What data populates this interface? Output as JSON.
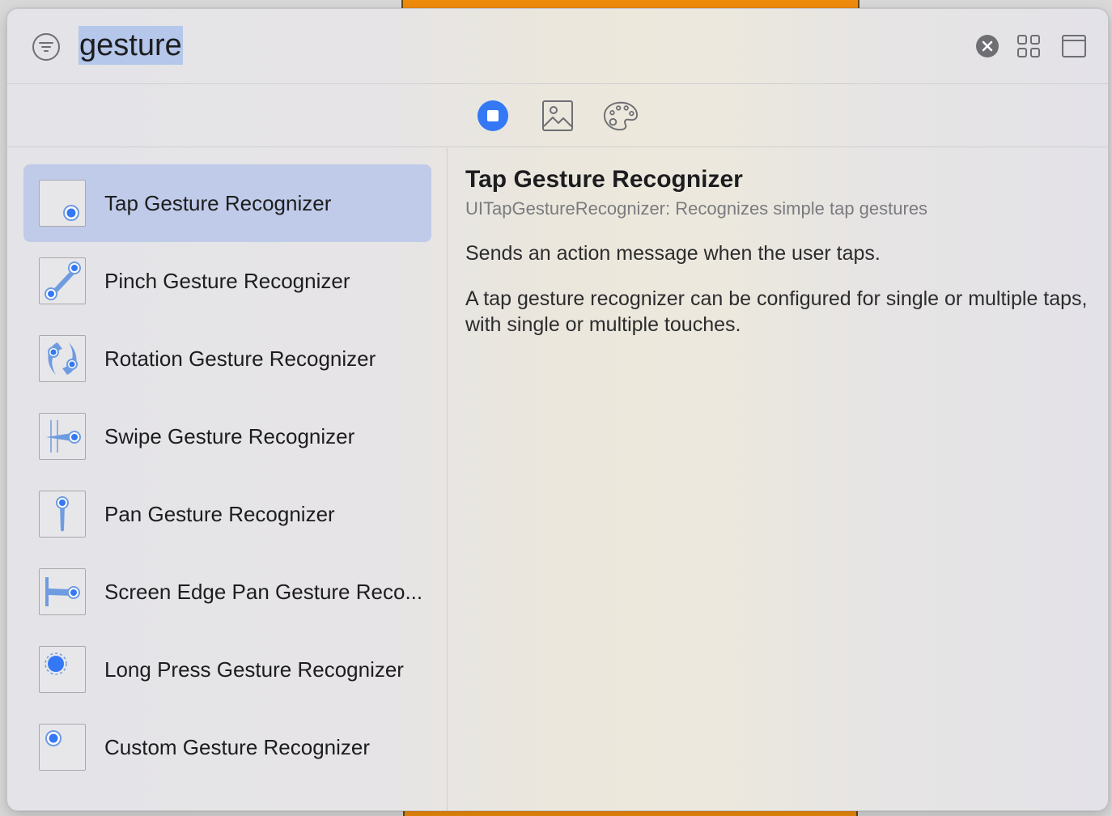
{
  "search": {
    "query": "gesture"
  },
  "tabs": [
    {
      "name": "objects",
      "active": true
    },
    {
      "name": "media",
      "active": false
    },
    {
      "name": "colors",
      "active": false
    }
  ],
  "library": {
    "items": [
      {
        "label": "Tap Gesture Recognizer",
        "icon": "tap-gesture-icon",
        "selected": true
      },
      {
        "label": "Pinch Gesture Recognizer",
        "icon": "pinch-gesture-icon"
      },
      {
        "label": "Rotation Gesture Recognizer",
        "icon": "rotation-gesture-icon"
      },
      {
        "label": "Swipe Gesture Recognizer",
        "icon": "swipe-gesture-icon"
      },
      {
        "label": "Pan Gesture Recognizer",
        "icon": "pan-gesture-icon"
      },
      {
        "label": "Screen Edge Pan Gesture Reco...",
        "icon": "screen-edge-pan-gesture-icon"
      },
      {
        "label": "Long Press Gesture Recognizer",
        "icon": "long-press-gesture-icon"
      },
      {
        "label": "Custom Gesture Recognizer",
        "icon": "custom-gesture-icon"
      }
    ]
  },
  "detail": {
    "title": "Tap Gesture Recognizer",
    "subtitle": "UITapGestureRecognizer: Recognizes simple tap gestures",
    "summary": "Sends an action message when the user taps.",
    "description": "A tap gesture recognizer can be configured for single or multiple taps, with single or multiple touches."
  },
  "colors": {
    "accent": "#3478f6",
    "selection": "#bfcbe8",
    "search_highlight": "#b5c7ea",
    "icon_blue": "#6f9be0",
    "backdrop_orange": "#f08c0c"
  }
}
